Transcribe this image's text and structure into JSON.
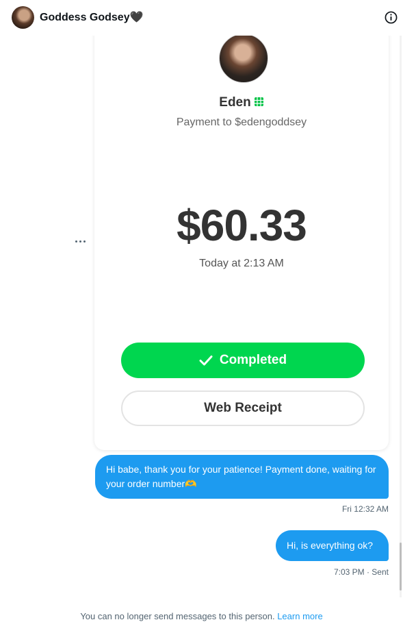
{
  "header": {
    "contact_name": "Goddess Godsey🖤",
    "info_icon": "info-circle-icon"
  },
  "payment_card": {
    "recipient_name": "Eden",
    "verified_icon": "cash-app-verified-icon",
    "subtitle": "Payment to $edengoddsey",
    "amount": "$60.33",
    "time": "Today at 2:13 AM",
    "completed_label": "Completed",
    "receipt_label": "Web Receipt",
    "accent_color": "#00d64f"
  },
  "messages": [
    {
      "text": "Hi babe, thank you for your patience! Payment done, waiting for your order number🫶",
      "meta": "Fri 12:32 AM"
    },
    {
      "text": "Hi, is everything ok?",
      "meta": "7:03 PM · Sent"
    }
  ],
  "footer": {
    "note": "You can no longer send messages to this person.",
    "link": "Learn more"
  },
  "colors": {
    "bubble": "#1d9bf0",
    "muted": "#536471"
  }
}
